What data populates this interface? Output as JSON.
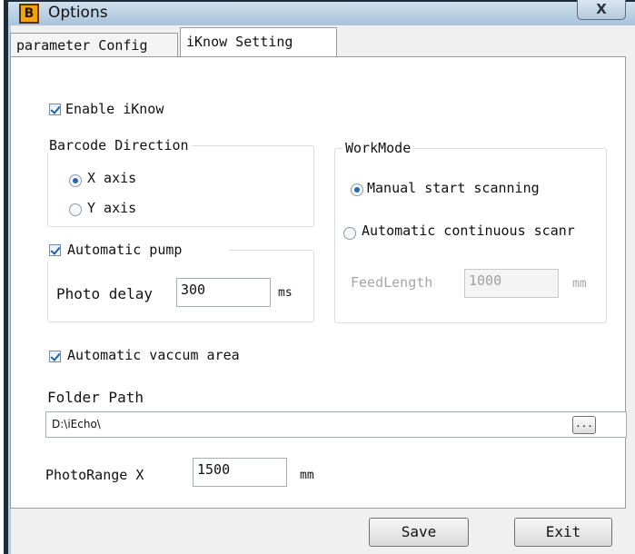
{
  "window": {
    "title": "Options",
    "app_icon_glyph": "B",
    "close_glyph": "X"
  },
  "tabs": [
    {
      "label": "parameter Config",
      "active": false
    },
    {
      "label": "iKnow Setting",
      "active": true
    }
  ],
  "iknow": {
    "enable_label": "Enable iKnow",
    "enable_checked": true,
    "barcode_direction": {
      "title": "Barcode Direction",
      "options": [
        {
          "label": "X axis",
          "selected": true
        },
        {
          "label": "Y axis",
          "selected": false
        }
      ]
    },
    "auto_pump": {
      "label": "Automatic pump",
      "checked": true,
      "photo_delay_label": "Photo delay",
      "photo_delay_value": "300",
      "photo_delay_unit": "ms"
    },
    "workmode": {
      "title": "WorkMode",
      "options": [
        {
          "label": "Manual start scanning",
          "selected": true
        },
        {
          "label": "Automatic continuous scanr",
          "selected": false
        }
      ],
      "feed_length_label": "FeedLength",
      "feed_length_value": "1000",
      "feed_length_unit": "mm"
    },
    "auto_vacuum": {
      "label": "Automatic vaccum area",
      "checked": true
    },
    "folder_path": {
      "label": "Folder Path",
      "value": "D:\\iEcho\\",
      "browse_label": "..."
    },
    "photo_range": {
      "label": "PhotoRange X",
      "value": "1500",
      "unit": "mm"
    }
  },
  "buttons": {
    "save": "Save",
    "exit": "Exit"
  },
  "colors": {
    "frame": "#1e2b38",
    "titlebar": "#b7cde0",
    "accent": "#2566b5"
  }
}
